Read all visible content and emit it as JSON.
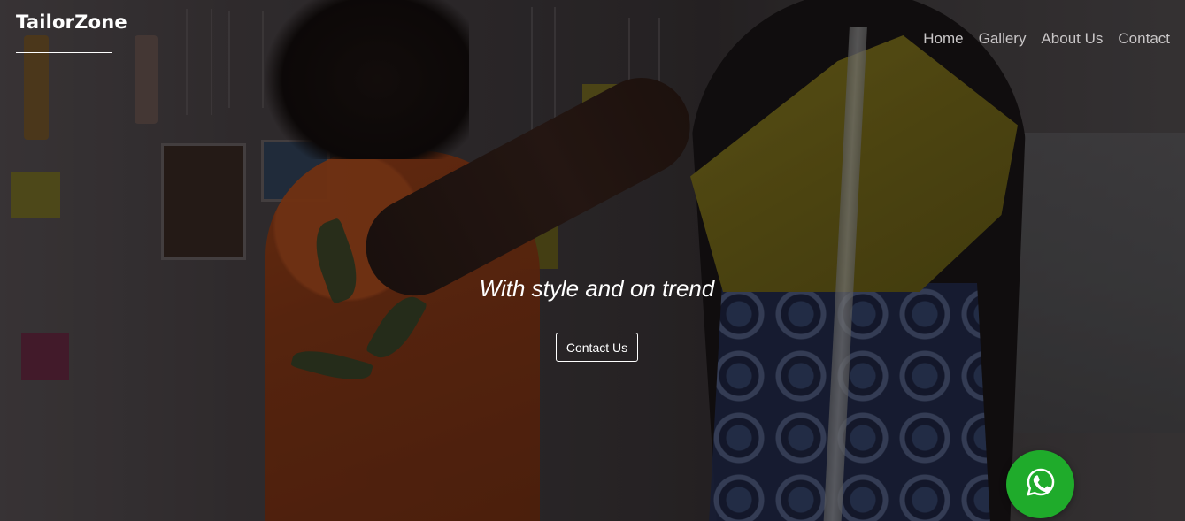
{
  "header": {
    "brand": "TailorZone",
    "nav": [
      {
        "label": "Home"
      },
      {
        "label": "Gallery"
      },
      {
        "label": "About Us"
      },
      {
        "label": "Contact"
      }
    ]
  },
  "hero": {
    "tagline": "With style and on trend",
    "cta_label": "Contact Us"
  },
  "floating": {
    "icon": "whatsapp-icon",
    "color": "#1fab2b"
  }
}
